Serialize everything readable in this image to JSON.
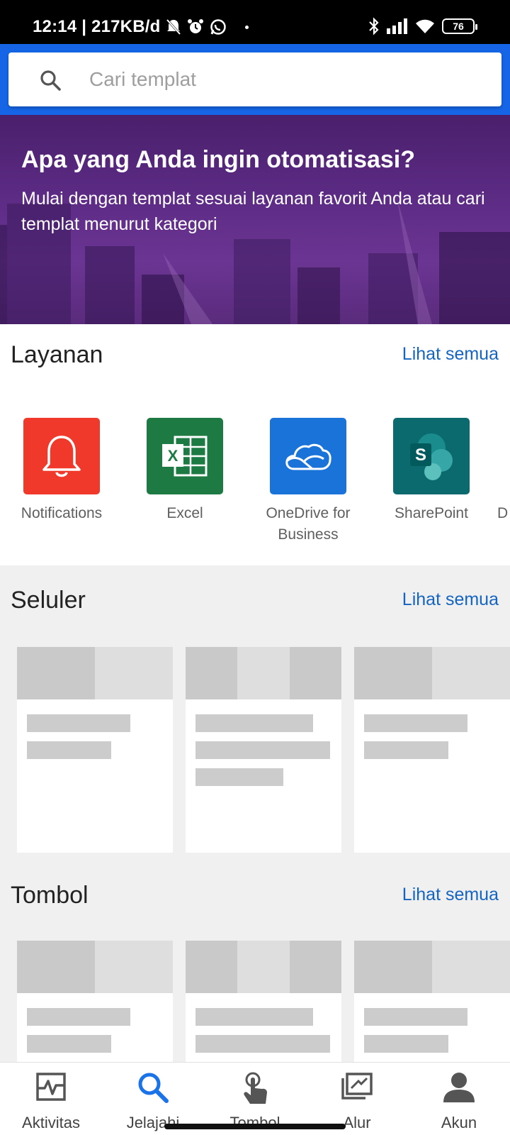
{
  "status_bar": {
    "time_info": "12:14 | 217KB/d",
    "battery": "76"
  },
  "search": {
    "placeholder": "Cari templat"
  },
  "hero": {
    "title": "Apa yang Anda ingin otomatisasi?",
    "subtitle": "Mulai dengan templat sesuai layanan favorit Anda atau cari templat menurut kategori"
  },
  "services": {
    "title": "Layanan",
    "see_all": "Lihat semua",
    "items": [
      {
        "label": "Notifications",
        "icon": "bell-icon",
        "color": "#f0392b"
      },
      {
        "label": "Excel",
        "icon": "excel-icon",
        "color": "#1e7a43"
      },
      {
        "label": "OneDrive for Business",
        "icon": "cloud-icon",
        "color": "#1a73d9"
      },
      {
        "label": "SharePoint",
        "icon": "sharepoint-icon",
        "color": "#0b6a6d"
      }
    ]
  },
  "mobile": {
    "title": "Seluler",
    "see_all": "Lihat semua"
  },
  "buttons": {
    "title": "Tombol",
    "see_all": "Lihat semua"
  },
  "bottom_nav": {
    "items": [
      {
        "label": "Aktivitas",
        "icon": "activity-icon"
      },
      {
        "label": "Jelajahi",
        "icon": "search-icon",
        "active": true
      },
      {
        "label": "Tombol",
        "icon": "touch-icon"
      },
      {
        "label": "Alur",
        "icon": "flow-icon"
      },
      {
        "label": "Akun",
        "icon": "person-icon"
      }
    ],
    "accent": "#1a73e8"
  }
}
